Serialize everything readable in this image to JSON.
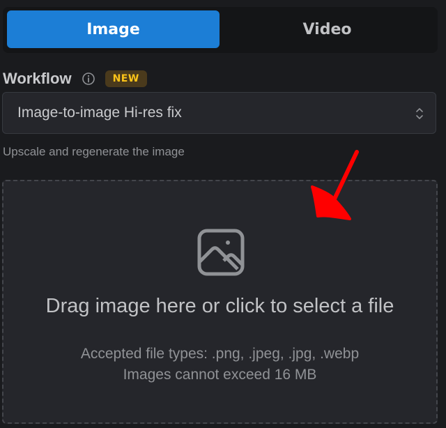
{
  "tabs": [
    {
      "label": "Image",
      "active": true
    },
    {
      "label": "Video",
      "active": false
    }
  ],
  "workflow": {
    "label": "Workflow",
    "info_icon": "info-circle-icon",
    "badge": "NEW",
    "selected": "Image-to-image Hi-res fix",
    "description": "Upscale and regenerate the image"
  },
  "dropzone": {
    "icon": "photo-icon",
    "title": "Drag image here or click to select a file",
    "accepted_types": "Accepted file types: .png, .jpeg, .jpg, .webp",
    "size_limit": "Images cannot exceed 16 MB"
  },
  "colors": {
    "accent": "#1c7ed6",
    "badge_text": "#fcc419",
    "annotation": "#ff0000"
  }
}
